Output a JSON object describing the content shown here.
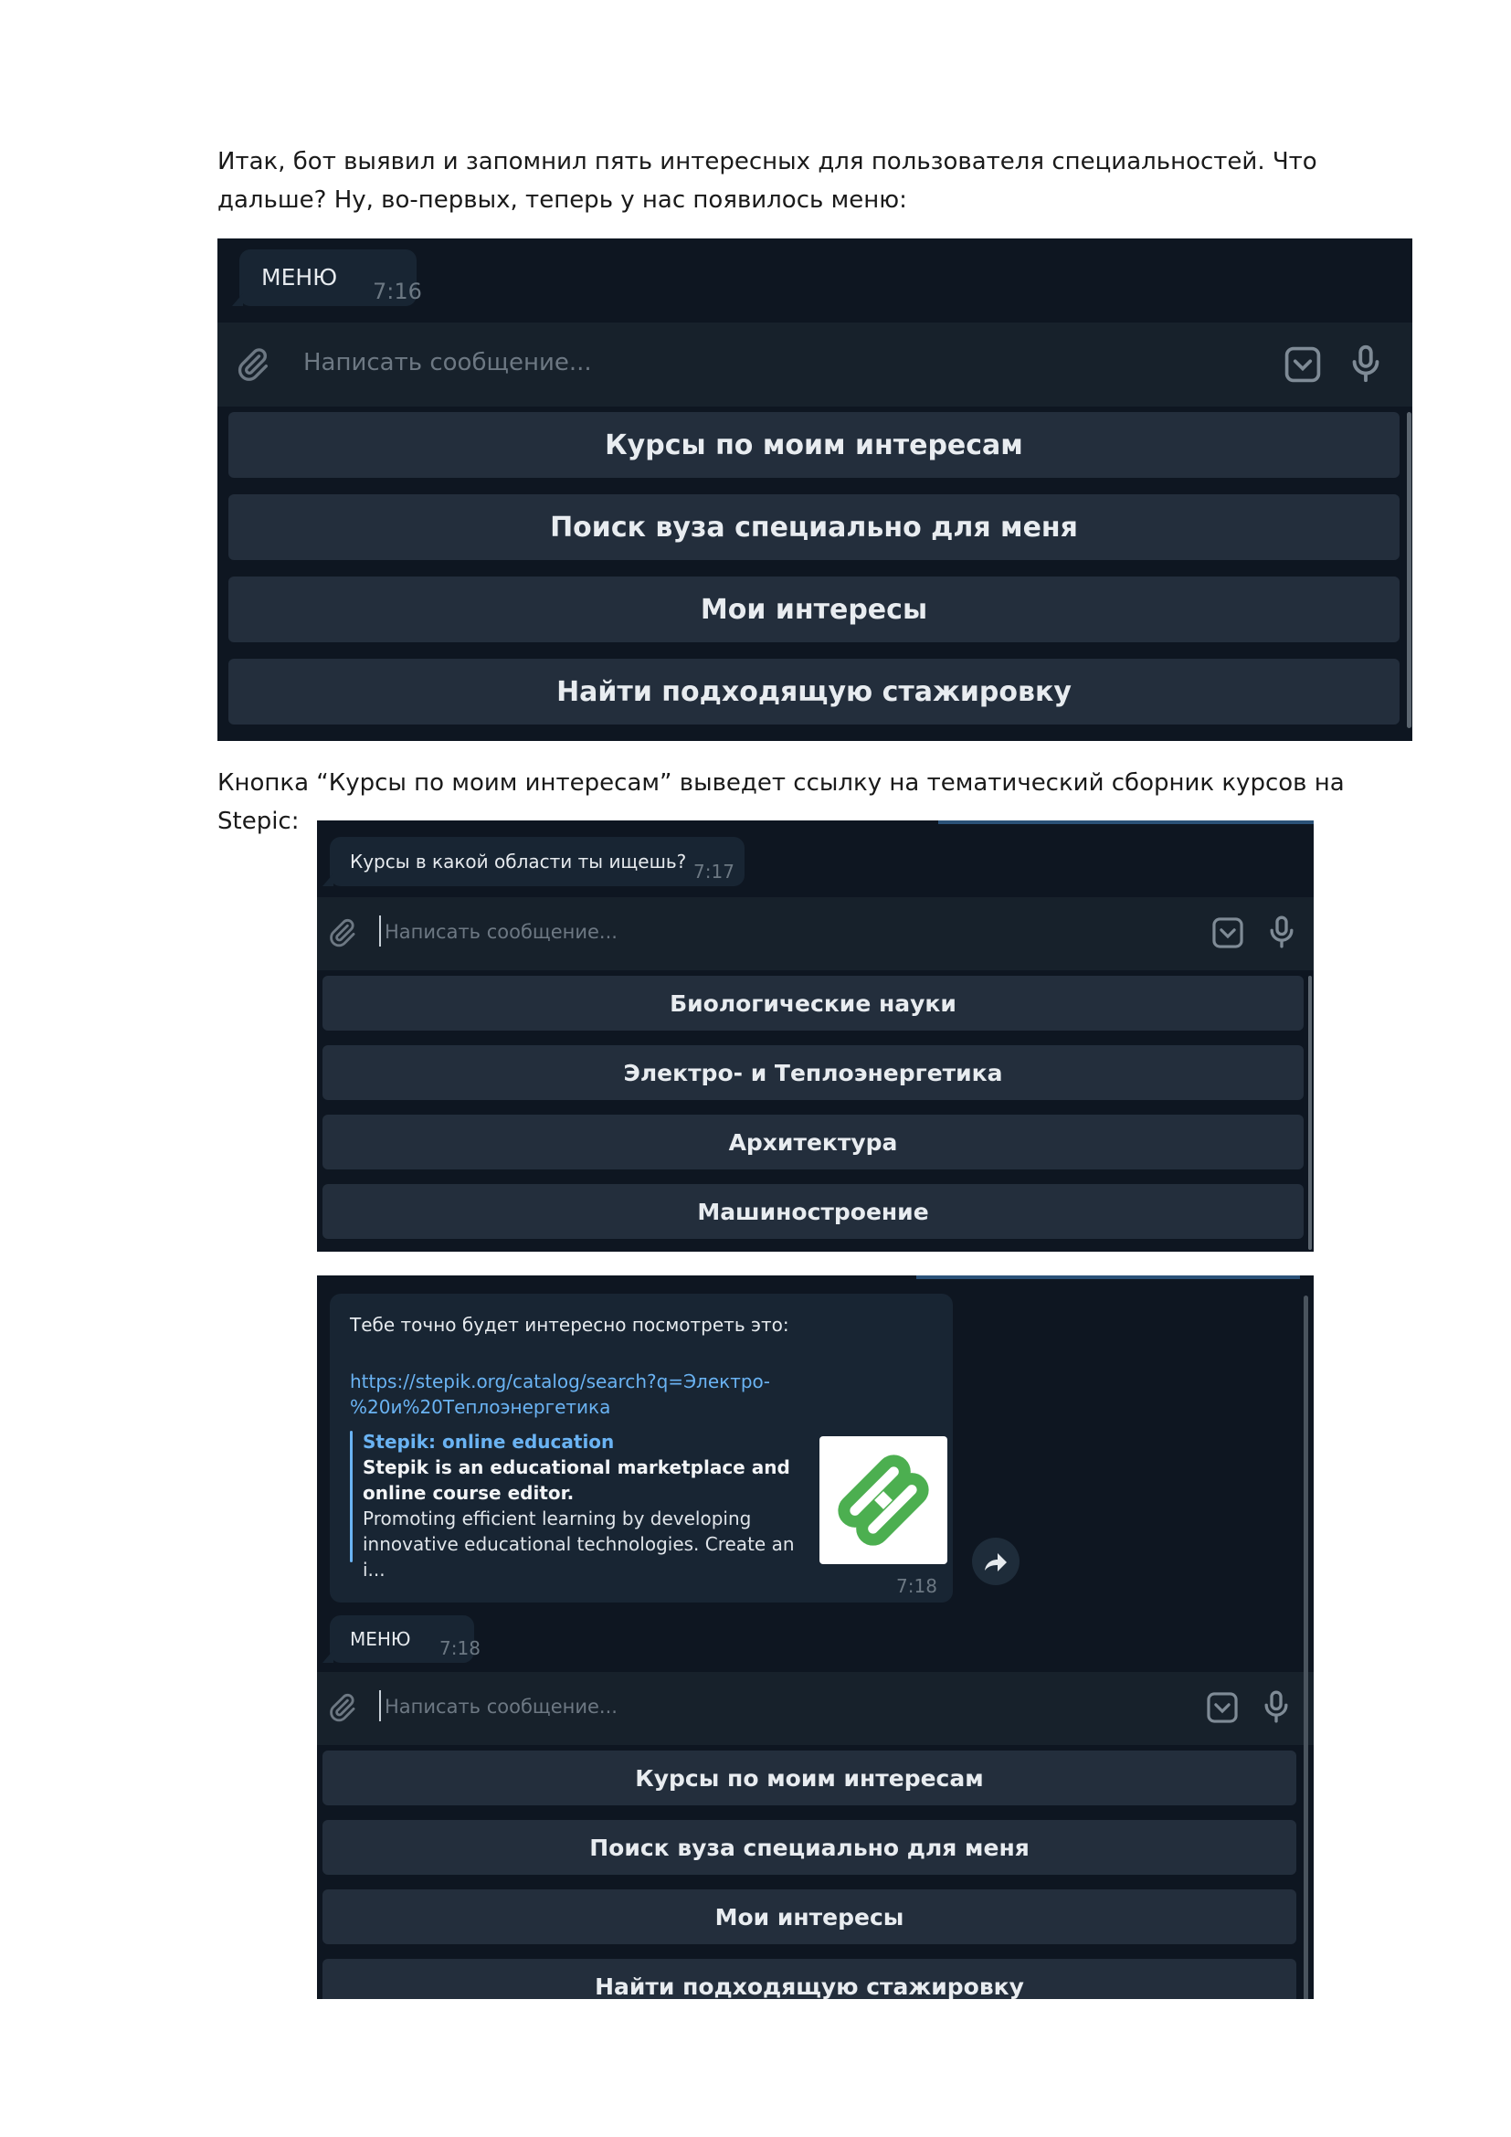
{
  "intro_text": "Итак, бот выявил и запомнил пять интересных для пользователя специальностей. Что дальше? Ну, во-первых, теперь у нас появилось меню:",
  "middle_text": "Кнопка “Курсы по моим интересам” выведет ссылку на тематический сборник курсов на Stepic:",
  "screenshot1": {
    "message": {
      "text": "МЕНЮ",
      "time": "7:16"
    },
    "input_placeholder": "Написать сообщение...",
    "keyboard": [
      "Курсы по моим интересам",
      "Поиск вуза специально для меня",
      "Мои интересы",
      "Найти подходящую стажировку"
    ]
  },
  "screenshot2": {
    "message": {
      "text": "Курсы в какой области ты ищешь?",
      "time": "7:17"
    },
    "input_placeholder": "Написать сообщение...",
    "keyboard": [
      "Биологические науки",
      "Электро- и Теплоэнергетика",
      "Архитектура",
      "Машиностроение"
    ]
  },
  "screenshot3": {
    "link_message": {
      "text": "Тебе точно будет интересно  посмотреть это:",
      "url_line1": "https://stepik.org/catalog/search?q=Электро-",
      "url_line2": "%20и%20Теплоэнергетика",
      "preview_site": "Stepik: online education",
      "preview_title": "Stepik is an educational marketplace and online course editor.",
      "preview_description": "Promoting efficient learning by developing innovative educational technologies. Create an i...",
      "time": "7:18"
    },
    "menu_message": {
      "text": "МЕНЮ",
      "time": "7:18"
    },
    "input_placeholder": "Написать сообщение...",
    "keyboard": [
      "Курсы по моим интересам",
      "Поиск вуза специально для меня",
      "Мои интересы",
      "Найти подходящую стажировку"
    ]
  },
  "colors": {
    "chat_background": "#0e1621",
    "bubble": "#182533",
    "input_bar": "#17212b",
    "keyboard_button": "#232e3c",
    "link": "#6ab3f3",
    "stepik_green": "#4caf50"
  },
  "icons": {
    "attach": "paperclip-icon",
    "bot_keyboard": "keyboard-toggle-icon",
    "microphone": "microphone-icon",
    "share": "share-icon",
    "stepik_logo": "stepik-logo"
  }
}
